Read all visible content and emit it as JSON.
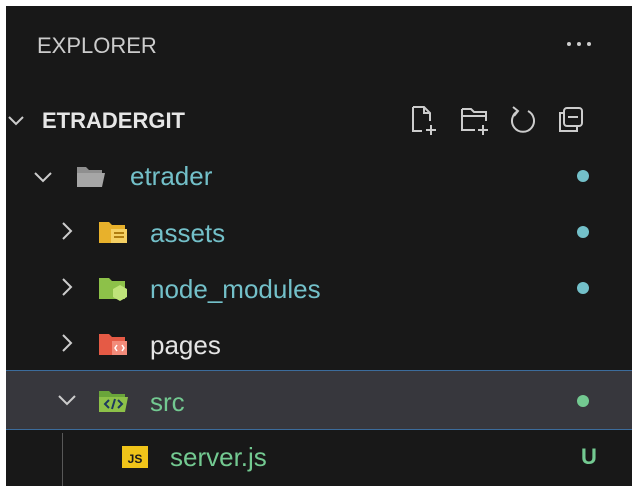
{
  "header": {
    "title": "EXPLORER",
    "more_icon": "ellipsis-icon"
  },
  "section": {
    "title": "ETRADERGIT",
    "actions": [
      {
        "icon": "new-file-icon"
      },
      {
        "icon": "new-folder-icon"
      },
      {
        "icon": "refresh-icon"
      },
      {
        "icon": "collapse-all-icon"
      }
    ]
  },
  "tree": {
    "etrader": {
      "label": "etrader",
      "label_color": "#73c0c9",
      "decoration_color": "#73c0c9"
    },
    "assets": {
      "label": "assets",
      "label_color": "#73c0c9",
      "decoration_color": "#73c0c9"
    },
    "node_modules": {
      "label": "node_modules",
      "label_color": "#73c0c9",
      "decoration_color": "#73c0c9"
    },
    "pages": {
      "label": "pages",
      "label_color": "#e4e4e4"
    },
    "src": {
      "label": "src",
      "label_color": "#73c991",
      "decoration_color": "#73c991",
      "selected": true
    },
    "server_js": {
      "label": "server.js",
      "label_color": "#73c991",
      "badge": "U",
      "badge_color": "#73c991"
    }
  },
  "colors": {
    "background": "#181818",
    "selection": "#37373d",
    "folder_gray": "#8f8f8f",
    "folder_yellow": "#e8b12b",
    "folder_green": "#8dc149",
    "folder_red": "#e55a45",
    "js_badge": "#f0c419"
  }
}
